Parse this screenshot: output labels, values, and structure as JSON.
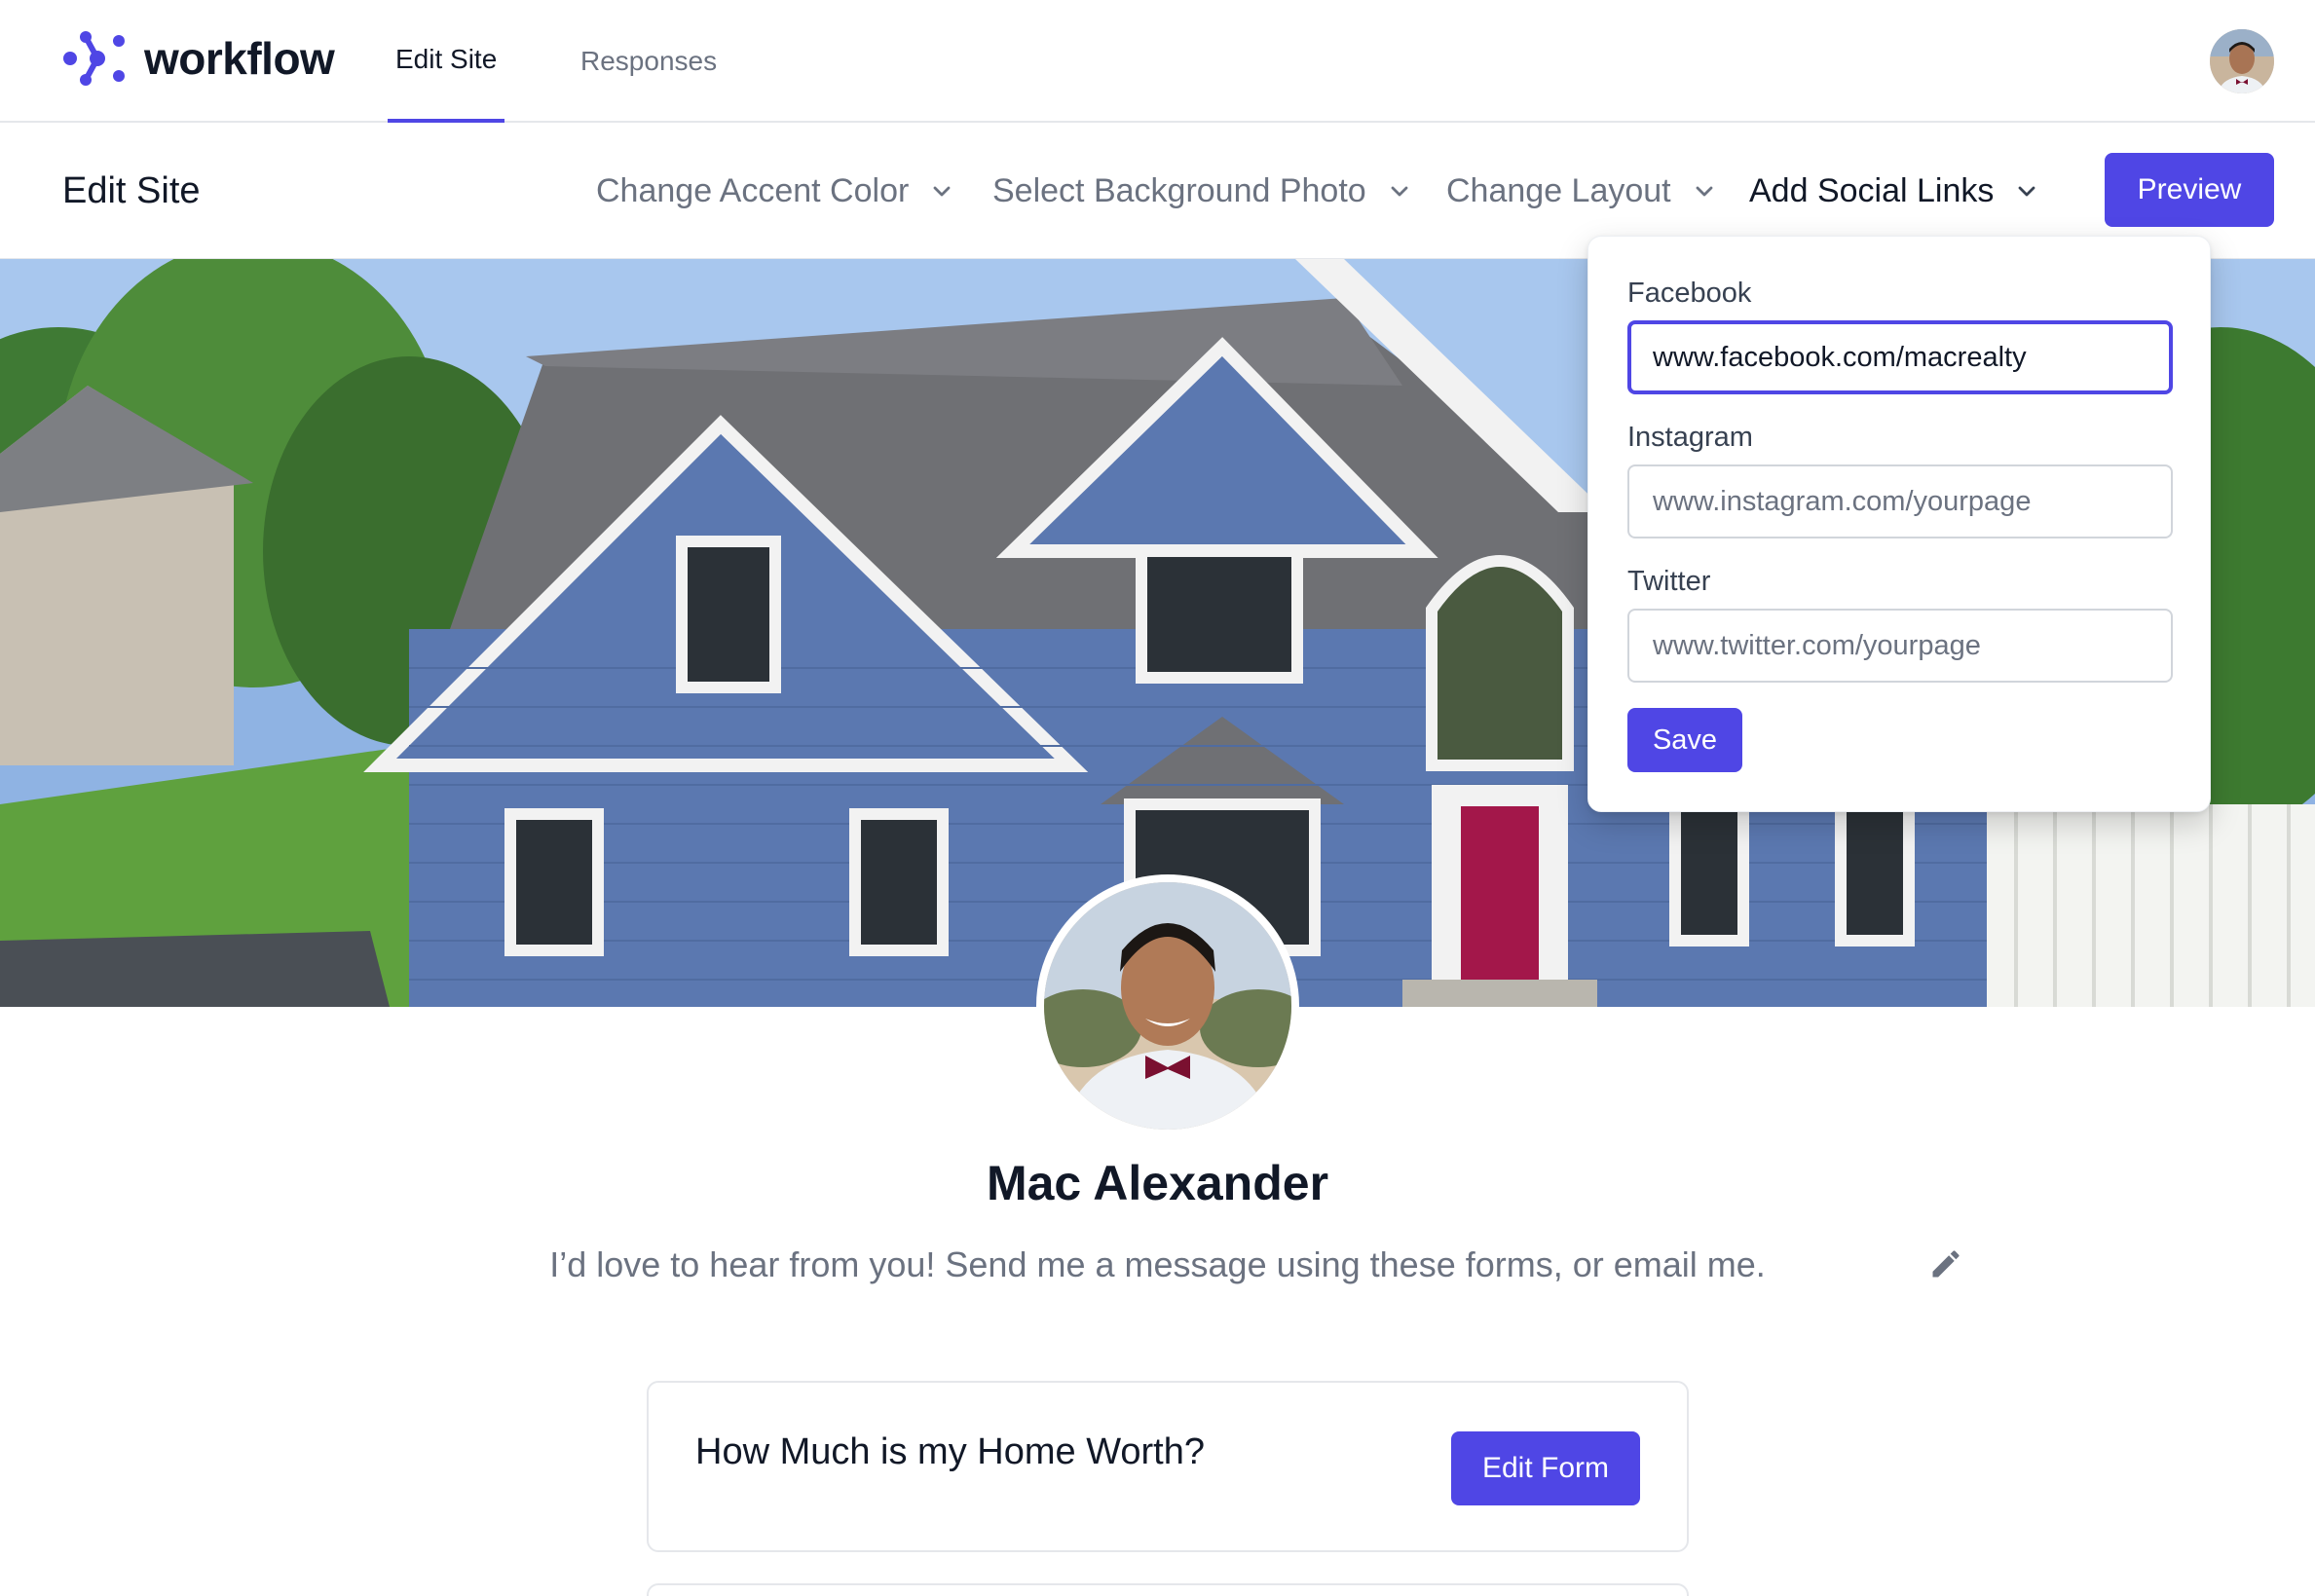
{
  "app": {
    "name": "workflow",
    "tabs": [
      {
        "label": "Edit Site",
        "active": true
      },
      {
        "label": "Responses",
        "active": false
      }
    ],
    "user_avatar": "user-avatar"
  },
  "subheader": {
    "title": "Edit Site",
    "menu": [
      {
        "label": "Change Accent Color",
        "icon": "chevron-down-icon"
      },
      {
        "label": "Select Background Photo",
        "icon": "chevron-down-icon"
      },
      {
        "label": "Change Layout",
        "icon": "chevron-down-icon"
      },
      {
        "label": "Add Social Links",
        "icon": "chevron-down-icon",
        "open": true
      }
    ],
    "preview_label": "Preview"
  },
  "social_links": {
    "facebook": {
      "label": "Facebook",
      "value": "www.facebook.com/macrealty",
      "placeholder": ""
    },
    "instagram": {
      "label": "Instagram",
      "value": "",
      "placeholder": "www.instagram.com/yourpage"
    },
    "twitter": {
      "label": "Twitter",
      "value": "",
      "placeholder": "www.twitter.com/yourpage"
    },
    "save_label": "Save"
  },
  "profile": {
    "name": "Mac Alexander",
    "description": "I’d love to hear from you! Send me a message using these forms, or email me."
  },
  "forms": [
    {
      "title": "How Much is my Home Worth?",
      "button_label": "Edit Form"
    }
  ],
  "colors": {
    "accent": "#4f46e5",
    "house_siding": "#5b78b0",
    "door": "#a3174a"
  }
}
